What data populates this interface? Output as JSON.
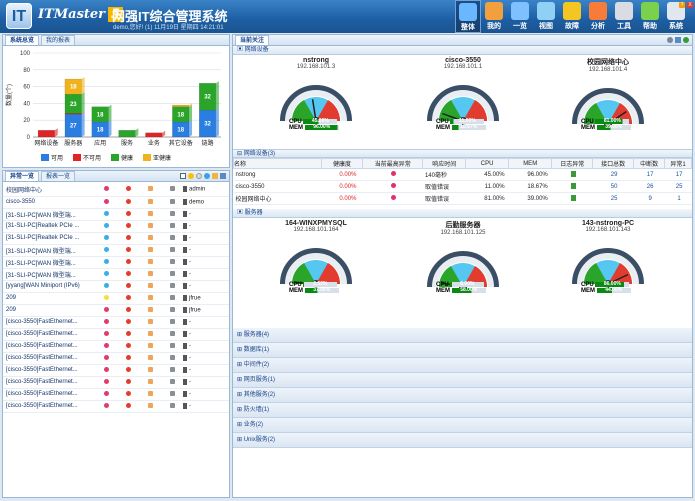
{
  "header": {
    "brand": "ITMaster",
    "version": "5",
    "title": "网强IT综合管理系统",
    "userinfo": "demo,您好! (1) 11月19日 星期四 14:21:01",
    "nav": [
      {
        "label": "整体",
        "color": "#6ab6ff",
        "active": true
      },
      {
        "label": "我的",
        "color": "#f2a03d"
      },
      {
        "label": "一览",
        "color": "#7fc0ff"
      },
      {
        "label": "视图",
        "color": "#8fd0f5"
      },
      {
        "label": "故障",
        "color": "#f3c623"
      },
      {
        "label": "分析",
        "color": "#f77c3a"
      },
      {
        "label": "工具",
        "color": "#d9dde3"
      },
      {
        "label": "帮助",
        "color": "#7bd14b"
      },
      {
        "label": "系统",
        "color": "#e0e7ef"
      }
    ],
    "help": "?",
    "close": "X"
  },
  "left_top": {
    "tabs": [
      "系统总览",
      "我的报表"
    ],
    "ylabel": "数量(个)",
    "legend": [
      {
        "label": "可用",
        "color": "#2a7de1"
      },
      {
        "label": "不可用",
        "color": "#e02424"
      },
      {
        "label": "健康",
        "color": "#2aa52a"
      },
      {
        "label": "亚健康",
        "color": "#f2b21b"
      }
    ]
  },
  "chart_data": {
    "type": "bar",
    "stacked": true,
    "categories": [
      "网络设备",
      "服务器",
      "应用",
      "服务",
      "业务",
      "其它设备",
      "链路"
    ],
    "ylim": [
      0,
      100
    ],
    "yticks": [
      0,
      20,
      40,
      60,
      80,
      100
    ],
    "ylabel": "数量(个)",
    "series": [
      {
        "name": "可用",
        "values": [
          0,
          27,
          18,
          0,
          0,
          18,
          32
        ]
      },
      {
        "name": "不可用",
        "values": [
          8,
          1,
          0,
          0,
          5,
          0,
          0
        ]
      },
      {
        "name": "健康",
        "values": [
          0,
          23,
          18,
          8,
          0,
          18,
          32
        ]
      },
      {
        "name": "亚健康",
        "values": [
          0,
          18,
          0,
          0,
          0,
          2,
          0
        ]
      }
    ],
    "data_labels": [
      {
        "category": "服务器",
        "series": "可用",
        "text": "27"
      },
      {
        "category": "服务器",
        "series": "健康",
        "text": "23"
      },
      {
        "category": "服务器",
        "series": "亚健康",
        "text": "18"
      },
      {
        "category": "应用",
        "series": "可用",
        "text": "18"
      },
      {
        "category": "应用",
        "series": "健康",
        "text": "18"
      },
      {
        "category": "其它设备",
        "series": "可用",
        "text": "18"
      },
      {
        "category": "其它设备",
        "series": "健康",
        "text": "18"
      },
      {
        "category": "链路",
        "series": "可用",
        "text": "32"
      },
      {
        "category": "链路",
        "series": "健康",
        "text": "32"
      }
    ]
  },
  "left_bottom": {
    "tabs": [
      "异常一览",
      "报表一览"
    ],
    "rows": [
      {
        "name": "校园网络中心",
        "user": "admin"
      },
      {
        "name": "cisco-3550",
        "user": "demo"
      },
      {
        "name": "[31-SLI-PC]WAN 微型端...",
        "user": "-"
      },
      {
        "name": "[31-SLI-PC]Realtek PCIe ...",
        "user": "-"
      },
      {
        "name": "[31-SLI-PC]Realtek PCIe ...",
        "user": "-"
      },
      {
        "name": "[31-SLI-PC]WAN 微型端...",
        "user": "-"
      },
      {
        "name": "[31-SLI-PC]WAN 微型端...",
        "user": "-"
      },
      {
        "name": "[31-SLI-PC]WAN 微型端...",
        "user": "-"
      },
      {
        "name": "[yyang]WAN Miniport (IPv6)",
        "user": "-"
      },
      {
        "name": "209",
        "user": "jfrue"
      },
      {
        "name": "209",
        "user": "jfrue"
      },
      {
        "name": "[cisco-3550]FastEthernet...",
        "user": "-"
      },
      {
        "name": "[cisco-3550]FastEthernet...",
        "user": "-"
      },
      {
        "name": "[cisco-3550]FastEthernet...",
        "user": "-"
      },
      {
        "name": "[cisco-3550]FastEthernet...",
        "user": "-"
      },
      {
        "name": "[cisco-3550]FastEthernet...",
        "user": "-"
      },
      {
        "name": "[cisco-3550]FastEthernet...",
        "user": "-"
      },
      {
        "name": "[cisco-3550]FastEthernet...",
        "user": "-"
      },
      {
        "name": "[cisco-3550]FastEthernet...",
        "user": "-"
      }
    ]
  },
  "right": {
    "tab": "当前关注",
    "net_title": "网络设备",
    "server_title": "服务器",
    "net_gauges": [
      {
        "name": "nstrong",
        "ip": "192.168.101.3",
        "cpu": "45.00%",
        "mem": "96.00%",
        "cpu_val": 45,
        "mem_val": 96
      },
      {
        "name": "cisco-3550",
        "ip": "192.168.101.1",
        "cpu": "11.00%",
        "mem": "18.67%",
        "cpu_val": 11,
        "mem_val": 18.67
      },
      {
        "name": "校园网络中心",
        "ip": "192.168.101.4",
        "cpu": "81.00%",
        "mem": "39.00%",
        "cpu_val": 81,
        "mem_val": 39
      }
    ],
    "server_gauges": [
      {
        "name": "164-WINXPMYSQL",
        "ip": "192.168.101.164",
        "cpu": "2.50%",
        "mem": "37.00%",
        "cpu_val": 2.5,
        "mem_val": 37
      },
      {
        "name": "后勤服务器",
        "ip": "192.168.101.125",
        "cpu": "6.00%",
        "mem": "58.00%",
        "cpu_val": 6,
        "mem_val": 58
      },
      {
        "name": "143-nstrong-PC",
        "ip": "192.168.101.143",
        "cpu": "86.00%",
        "mem": "44.00%",
        "cpu_val": 86,
        "mem_val": 44
      }
    ],
    "gauge_labels": {
      "cpu": "CPU",
      "mem": "MEM"
    },
    "table_group": "网络设备(3)",
    "table_headers": [
      "名称",
      "健康度",
      "当前最高异常",
      "响应时间",
      "CPU",
      "MEM",
      "日志异常",
      "接口总数",
      "中断数",
      "异常1"
    ],
    "table_rows": [
      {
        "name": "nstrong",
        "health": "0.00%",
        "resp": "140毫秒",
        "cpu": "45.00%",
        "mem": "96.00%",
        "ports": "29",
        "intr": "17",
        "err": "17"
      },
      {
        "name": "cisco-3550",
        "health": "0.00%",
        "resp": "取值错误",
        "cpu": "11.00%",
        "mem": "18.67%",
        "ports": "50",
        "intr": "26",
        "err": "25"
      },
      {
        "name": "校园网络中心",
        "health": "0.00%",
        "resp": "取值错误",
        "cpu": "81.00%",
        "mem": "39.00%",
        "ports": "25",
        "intr": "9",
        "err": "1"
      }
    ],
    "groups": [
      "服务器(4)",
      "数据库(1)",
      "中间件(2)",
      "网页服务(1)",
      "其他服务(2)",
      "防火墙(1)",
      "业务(2)",
      "Unix服务(2)"
    ]
  }
}
